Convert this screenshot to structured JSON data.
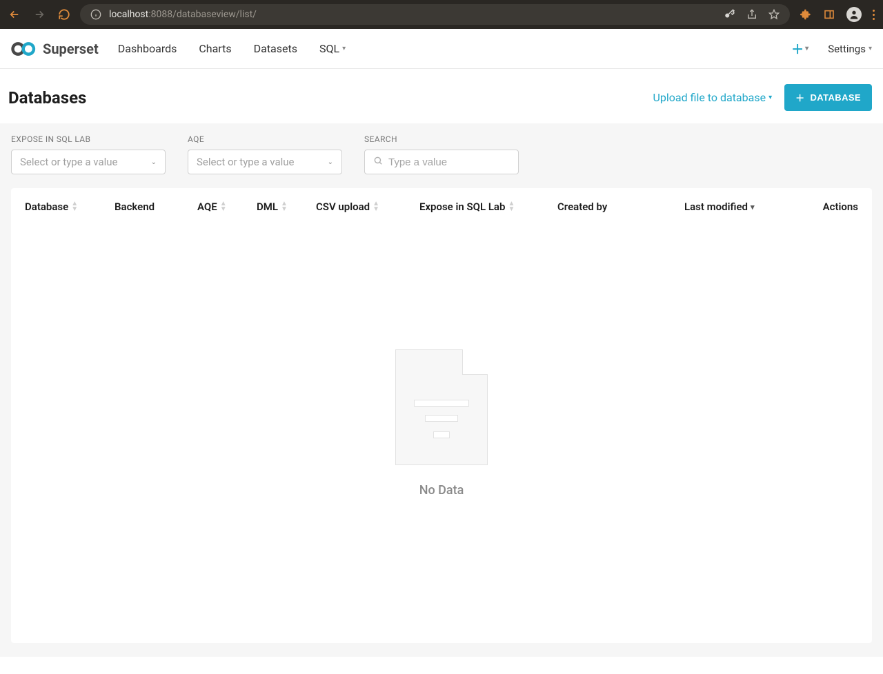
{
  "browser": {
    "url_host": "localhost",
    "url_rest": ":8088/databaseview/list/"
  },
  "brand": "Superset",
  "nav": {
    "dashboards": "Dashboards",
    "charts": "Charts",
    "datasets": "Datasets",
    "sql": "SQL",
    "settings": "Settings"
  },
  "page": {
    "title": "Databases",
    "upload_link": "Upload file to database",
    "add_button": "DATABASE"
  },
  "filters": {
    "expose_label": "EXPOSE IN SQL LAB",
    "aqe_label": "AQE",
    "search_label": "SEARCH",
    "select_placeholder": "Select or type a value",
    "search_placeholder": "Type a value"
  },
  "columns": {
    "database": "Database",
    "backend": "Backend",
    "aqe": "AQE",
    "dml": "DML",
    "csv": "CSV upload",
    "expose": "Expose in SQL Lab",
    "created": "Created by",
    "modified": "Last modified",
    "actions": "Actions"
  },
  "empty_text": "No Data"
}
